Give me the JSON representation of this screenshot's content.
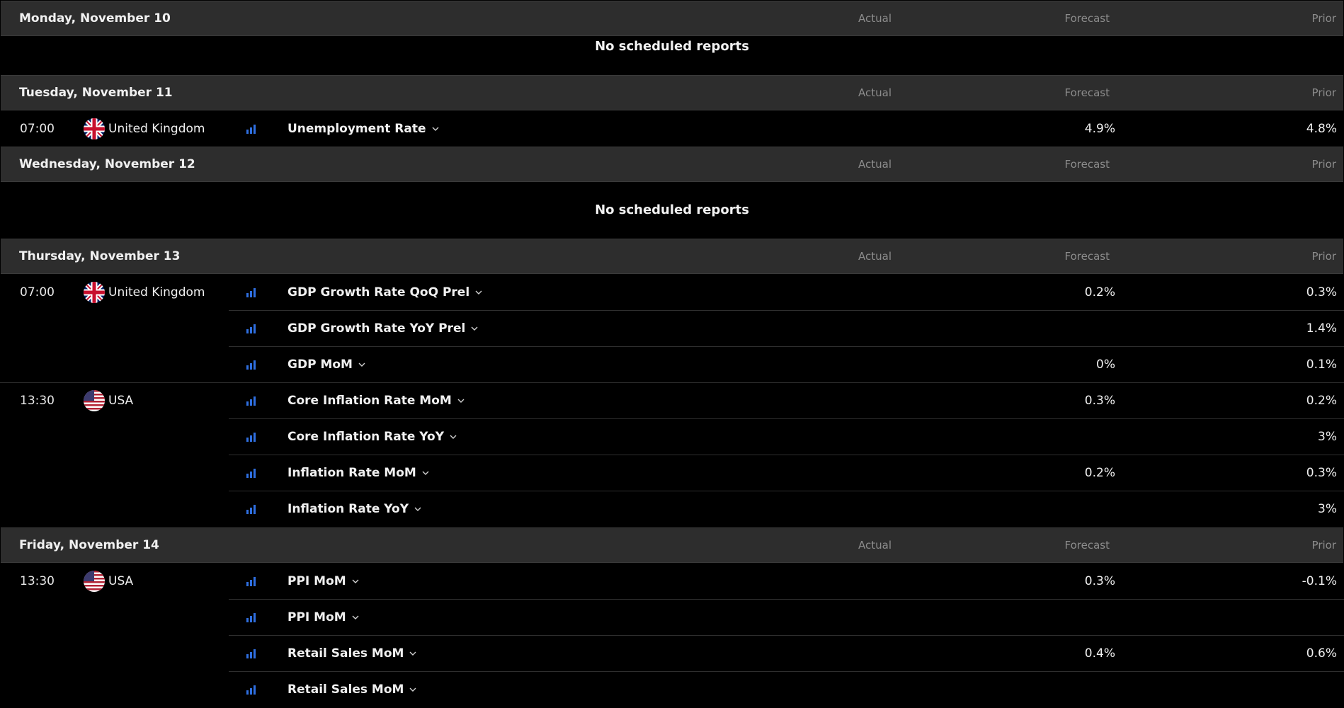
{
  "columns": {
    "actual": "Actual",
    "forecast": "Forecast",
    "prior": "Prior"
  },
  "colors": {
    "background": "#000000",
    "header_background": "#2d2d2d",
    "column_header_text": "#8c8c8c",
    "importance_icon": "#2f6fe0"
  },
  "days": [
    {
      "title": "Monday, November 10",
      "no_reports": "No scheduled reports"
    },
    {
      "title": "Tuesday, November 11",
      "events": [
        {
          "time": "07:00",
          "country": "United Kingdom",
          "flag": "uk-flag-icon",
          "name": "Unemployment Rate",
          "actual": "",
          "forecast": "4.9%",
          "prior": "4.8%"
        }
      ]
    },
    {
      "title": "Wednesday, November 12",
      "no_reports": "No scheduled reports"
    },
    {
      "title": "Thursday, November 13",
      "events": [
        {
          "time": "07:00",
          "country": "United Kingdom",
          "flag": "uk-flag-icon",
          "name": "GDP Growth Rate QoQ Prel",
          "actual": "",
          "forecast": "0.2%",
          "prior": "0.3%"
        },
        {
          "name": "GDP Growth Rate YoY Prel",
          "actual": "",
          "forecast": "",
          "prior": "1.4%"
        },
        {
          "name": "GDP MoM",
          "actual": "",
          "forecast": "0%",
          "prior": "0.1%"
        },
        {
          "time": "13:30",
          "country": "USA",
          "flag": "us-flag-icon",
          "name": "Core Inflation Rate MoM",
          "actual": "",
          "forecast": "0.3%",
          "prior": "0.2%"
        },
        {
          "name": "Core Inflation Rate YoY",
          "actual": "",
          "forecast": "",
          "prior": "3%"
        },
        {
          "name": "Inflation Rate MoM",
          "actual": "",
          "forecast": "0.2%",
          "prior": "0.3%"
        },
        {
          "name": "Inflation Rate YoY",
          "actual": "",
          "forecast": "",
          "prior": "3%"
        }
      ]
    },
    {
      "title": "Friday, November 14",
      "events": [
        {
          "time": "13:30",
          "country": "USA",
          "flag": "us-flag-icon",
          "name": "PPI MoM",
          "actual": "",
          "forecast": "0.3%",
          "prior": "-0.1%"
        },
        {
          "name": "PPI MoM",
          "actual": "",
          "forecast": "",
          "prior": ""
        },
        {
          "name": "Retail Sales MoM",
          "actual": "",
          "forecast": "0.4%",
          "prior": "0.6%"
        },
        {
          "name": "Retail Sales MoM",
          "actual": "",
          "forecast": "",
          "prior": ""
        }
      ]
    }
  ]
}
